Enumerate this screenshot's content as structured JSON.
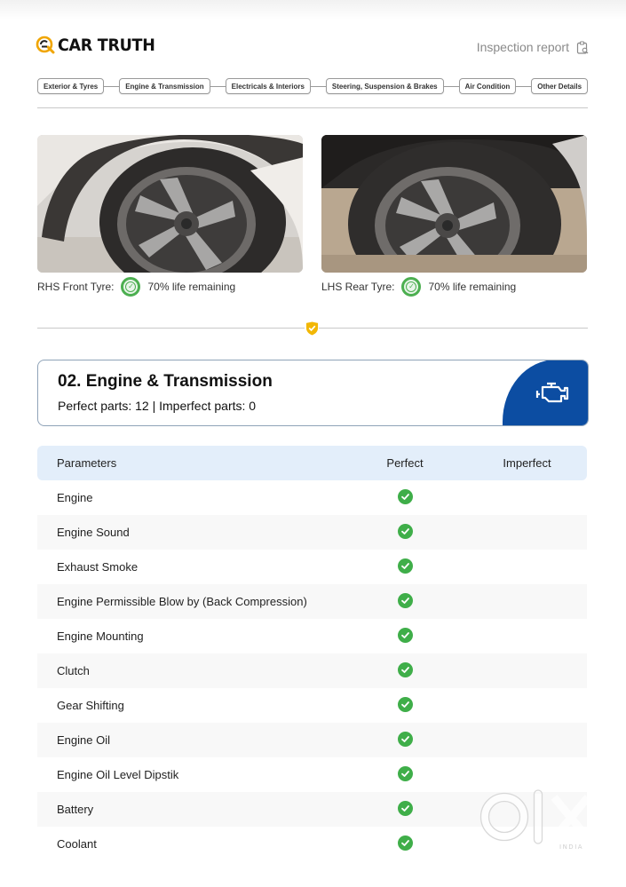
{
  "brand": {
    "name": "CAR TRUTH",
    "accent": "#f0a500"
  },
  "header": {
    "report_label": "Inspection report",
    "report_icon": "clipboard-icon"
  },
  "steps": [
    "Exterior & Tyres",
    "Engine & Transmission",
    "Electricals & Interiors",
    "Steering, Suspension & Brakes",
    "Air Condition",
    "Other Details"
  ],
  "tyres": [
    {
      "label": "RHS Front Tyre:",
      "life": "70% life remaining",
      "life_fraction": 0.7
    },
    {
      "label": "LHS Rear Tyre:",
      "life": "70% life remaining",
      "life_fraction": 0.7
    }
  ],
  "section": {
    "title": "02. Engine & Transmission",
    "summary": "Perfect parts: 12 | Imperfect parts: 0",
    "icon": "engine-icon",
    "accent": "#0c4da2"
  },
  "table": {
    "headers": [
      "Parameters",
      "Perfect",
      "Imperfect"
    ],
    "rows": [
      {
        "name": "Engine",
        "status": "perfect"
      },
      {
        "name": "Engine Sound",
        "status": "perfect"
      },
      {
        "name": "Exhaust Smoke",
        "status": "perfect"
      },
      {
        "name": "Engine Permissible Blow by (Back Compression)",
        "status": "perfect"
      },
      {
        "name": "Engine Mounting",
        "status": "perfect"
      },
      {
        "name": "Clutch",
        "status": "perfect"
      },
      {
        "name": "Gear Shifting",
        "status": "perfect"
      },
      {
        "name": "Engine Oil",
        "status": "perfect"
      },
      {
        "name": "Engine Oil Level Dipstik",
        "status": "perfect"
      },
      {
        "name": "Battery",
        "status": "perfect"
      },
      {
        "name": "Coolant",
        "status": "perfect"
      }
    ]
  },
  "watermark": {
    "text": "OLX",
    "sub": "INDIA"
  },
  "colors": {
    "success": "#3fae49",
    "header_row": "#e3eefa"
  }
}
